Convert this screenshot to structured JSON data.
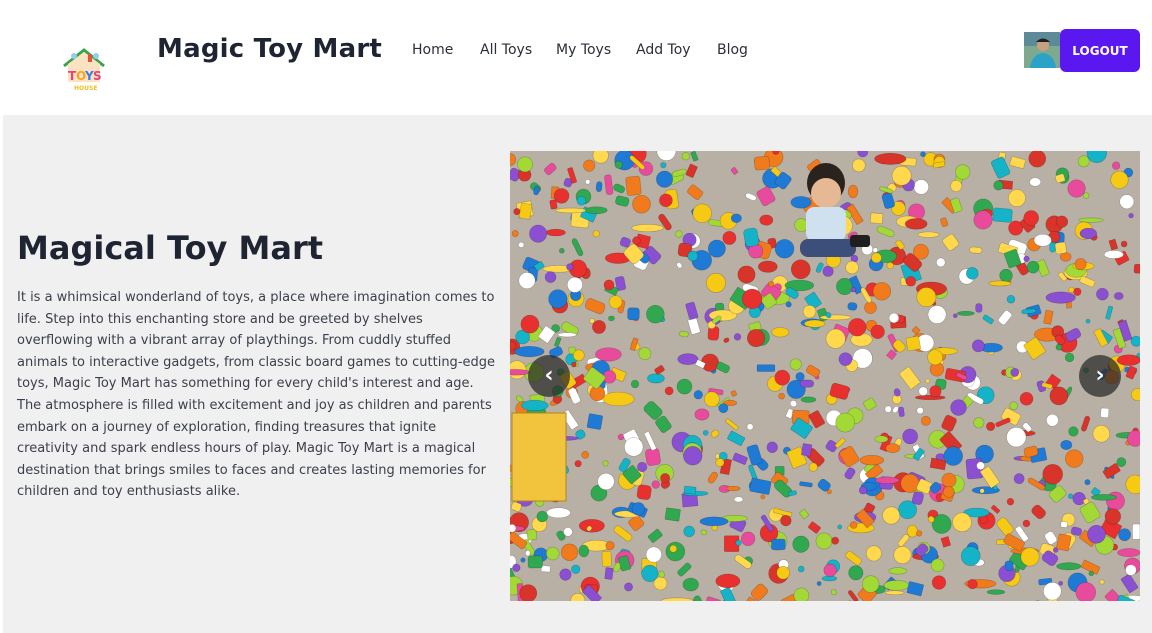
{
  "nav": {
    "brand": "Magic Toy Mart",
    "links": [
      {
        "label": "Home"
      },
      {
        "label": "All Toys"
      },
      {
        "label": "My Toys"
      },
      {
        "label": "Add Toy"
      },
      {
        "label": "Blog"
      }
    ],
    "logout_label": "LOGOUT"
  },
  "hero": {
    "title": "Magical Toy Mart",
    "description": "It is a whimsical wonderland of toys, a place where imagination comes to life. Step into this enchanting store and be greeted by shelves overflowing with a vibrant array of playthings. From cuddly stuffed animals to interactive gadgets, from classic board games to cutting-edge toys, Magic Toy Mart has something for every child's interest and age. The atmosphere is filled with excitement and joy as children and parents embark on a journey of exploration, finding treasures that ignite creativity and spark endless hours of play. Magic Toy Mart is a magical destination that brings smiles to faces and creates lasting memories for children and toy enthusiasts alike."
  },
  "carousel": {
    "prev_glyph": "‹",
    "next_glyph": "›"
  },
  "colors": {
    "accent": "#5a17f0",
    "hero_background": "#f0f0f0",
    "heading": "#1f2433"
  }
}
